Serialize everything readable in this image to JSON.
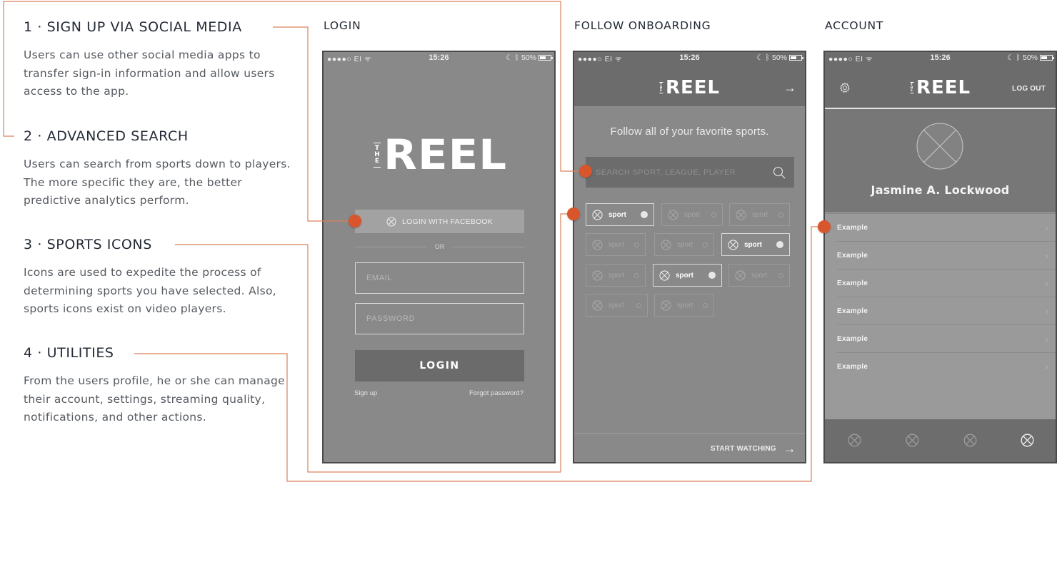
{
  "accent_color": "#d9552b",
  "annotations": [
    {
      "heading": "1 · SIGN UP VIA SOCIAL MEDIA",
      "body": "Users can use other social media apps to transfer sign-in information and allow users access to the app."
    },
    {
      "heading": "2 · ADVANCED SEARCH",
      "body": "Users can search from sports down to players. The more specific they are, the better predictive analytics perform."
    },
    {
      "heading": "3 · SPORTS ICONS",
      "body": "Icons are used to expedite the process of determining sports you have selected. Also, sports icons exist on video players."
    },
    {
      "heading": "4 · UTILITIES",
      "body": "From the users profile, he or she can manage their account, settings, streaming quality, notifications, and other actions."
    }
  ],
  "screen_titles": {
    "login": "LOGIN",
    "follow": "FOLLOW ONBOARDING",
    "account": "ACCOUNT"
  },
  "statusbar": {
    "carrier": "●●●●○ EI",
    "wifi_icon": "wifi-icon",
    "time": "15:26",
    "battery": "50%"
  },
  "logo": {
    "the": [
      "T",
      "H",
      "E"
    ],
    "reel": "REEL"
  },
  "login": {
    "facebook_button": "LOGIN WITH FACEBOOK",
    "or_label": "OR",
    "email_placeholder": "EMAIL",
    "password_placeholder": "PASSWORD",
    "login_button": "LOGIN",
    "signup_link": "Sign up",
    "forgot_link": "Forgot password?"
  },
  "follow": {
    "title": "Follow all of your favorite sports.",
    "search_placeholder": "SEARCH SPORT, LEAGUE, PLAYER",
    "sports": [
      {
        "label": "sport",
        "selected": true
      },
      {
        "label": "sport",
        "selected": false
      },
      {
        "label": "sport",
        "selected": false
      },
      {
        "label": "sport",
        "selected": false
      },
      {
        "label": "sport",
        "selected": false
      },
      {
        "label": "sport",
        "selected": true
      },
      {
        "label": "sport",
        "selected": false
      },
      {
        "label": "sport",
        "selected": true
      },
      {
        "label": "sport",
        "selected": false
      },
      {
        "label": "sport",
        "selected": false
      },
      {
        "label": "sport",
        "selected": false
      }
    ],
    "start_watching": "START WATCHING"
  },
  "account": {
    "logout": "LOG OUT",
    "name": "Jasmine A. Lockwood",
    "menu_items": [
      "Example",
      "Example",
      "Example",
      "Example",
      "Example",
      "Example"
    ],
    "tabs": [
      {
        "active": false
      },
      {
        "active": false
      },
      {
        "active": false
      },
      {
        "active": true
      }
    ]
  }
}
